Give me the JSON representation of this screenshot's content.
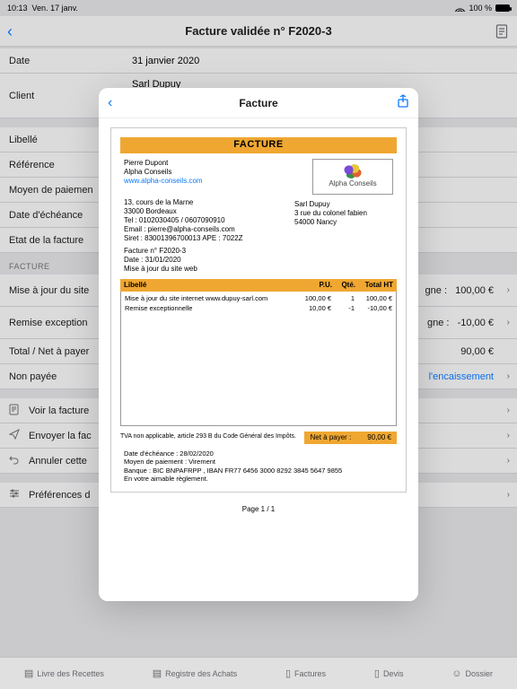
{
  "statusbar": {
    "time": "10:13",
    "date": "Ven. 17 janv.",
    "battery": "100 %"
  },
  "nav": {
    "title": "Facture validée n° F2020-3"
  },
  "fields": {
    "date_label": "Date",
    "date_value": "31 janvier 2020",
    "client_label": "Client",
    "client_value": "Sarl Dupuy",
    "libelle_label": "Libellé",
    "reference_label": "Référence",
    "moyen_label": "Moyen de paiemen",
    "echeance_label": "Date d'échéance",
    "etat_label": "Etat de la facture"
  },
  "section": {
    "facture": "Facture"
  },
  "lines": {
    "l1_label": "Mise à jour du site",
    "l1_right_label": "gne :",
    "l1_amount": "100,00 €",
    "l2_label": "Remise exception",
    "l2_right_label": "gne :",
    "l2_amount": "-10,00 €",
    "total_label": "Total / Net à payer",
    "total_amount": "90,00 €",
    "status_label": "Non payée",
    "status_link": "l'encaissement"
  },
  "actions": {
    "view": "Voir la facture",
    "send": "Envoyer la fac",
    "cancel": "Annuler cette",
    "prefs": "Préférences d"
  },
  "tabs": {
    "t1": "Livre des Recettes",
    "t2": "Registre des Achats",
    "t3": "Factures",
    "t4": "Devis",
    "t5": "Dossier"
  },
  "modal": {
    "title": "Facture",
    "billword": "FACTURE",
    "sender": {
      "name": "Pierre Dupont",
      "company": "Alpha Conseils",
      "site": "www.alpha-conseils.com",
      "addr1": "13, cours de la Marne",
      "addr2": "33000 Bordeaux",
      "tel": "Tel : 0102030405 / 0607090910",
      "email": "Email : pierre@alpha-conseils.com",
      "siret": "Siret : 83001396700013  APE : 7022Z"
    },
    "logo": "Alpha Conseils",
    "recipient": {
      "name": "Sarl Dupuy",
      "addr1": "3 rue du colonel fabien",
      "addr2": "54000 Nancy"
    },
    "meta": {
      "num": "Facture n° F2020-3",
      "date": "Date : 31/01/2020",
      "obj": "Mise à jour du site web"
    },
    "cols": {
      "c1": "Libellé",
      "c2": "P.U.",
      "c3": "Qté.",
      "c4": "Total HT"
    },
    "rows": [
      {
        "label": "Mise à jour du site internet www.dupuy-sarl.com",
        "pu": "100,00 €",
        "qte": "1",
        "tot": "100,00 €"
      },
      {
        "label": "Remise exceptionnelle",
        "pu": "10,00 €",
        "qte": "-1",
        "tot": "-10,00 €"
      }
    ],
    "tvanote": "TVA non applicable, article 293 B du Code Général des Impôts.",
    "net_label": "Net à payer :",
    "net_amount": "90,00 €",
    "footer": {
      "eche": "Date d'échéance : 28/02/2020",
      "moy": "Moyen de paiement : Virement",
      "bank": "Banque : BIC BNPAFRPP , IBAN FR77 6456 3000 8292 3845 5647 9855",
      "thanks": "En votre aimable règlement."
    },
    "page": "Page 1 / 1"
  }
}
